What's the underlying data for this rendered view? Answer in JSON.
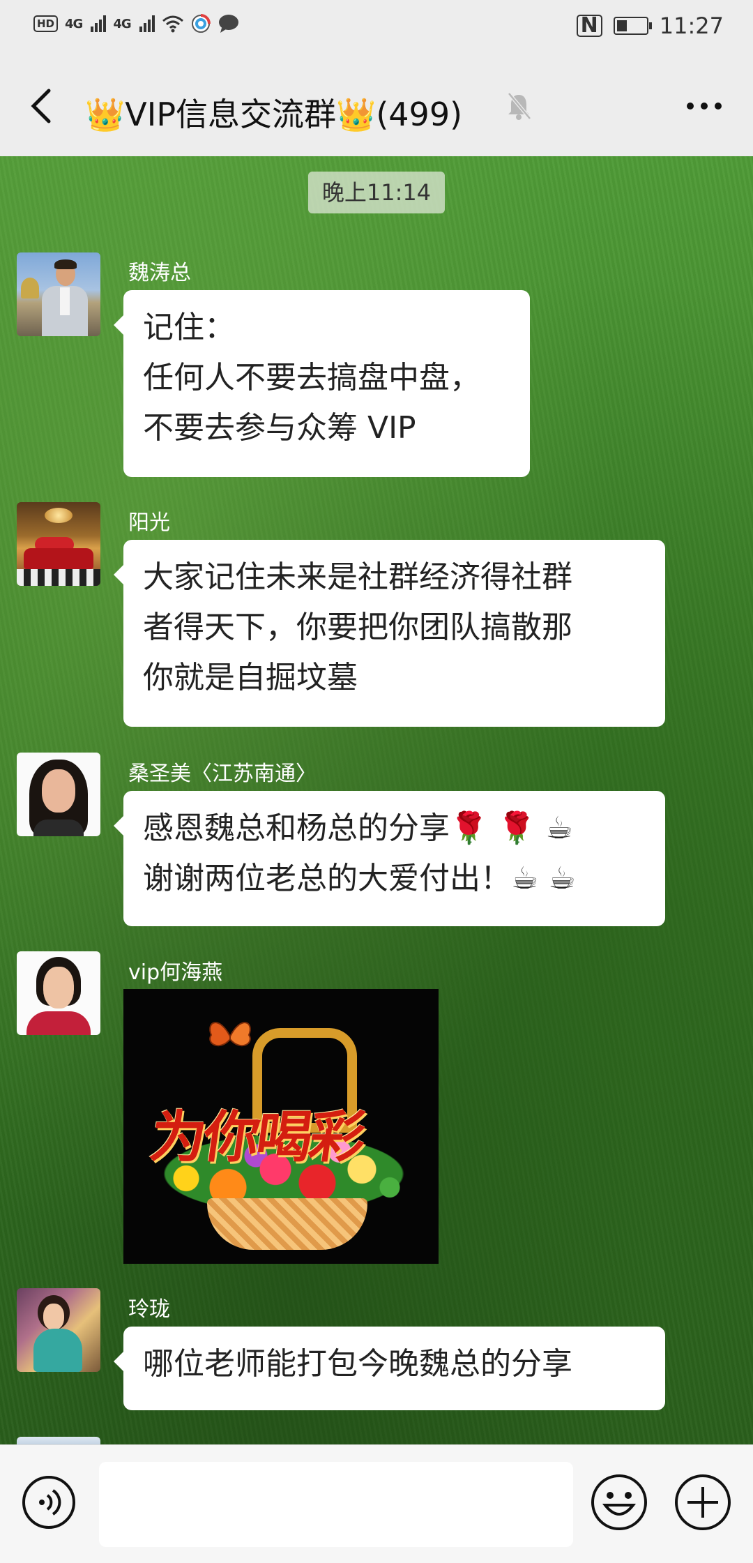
{
  "status_bar": {
    "hd": "HD",
    "signal1": "4G",
    "signal2": "4G",
    "nfc": "N",
    "time": "11:27"
  },
  "header": {
    "crown": "👑",
    "title": "VIP信息交流群",
    "member_count": "(499)"
  },
  "chat": {
    "timestamp": "晚上11:14",
    "messages": [
      {
        "sender": "魏涛总",
        "lines": [
          "记住：",
          "任何人不要去搞盘中盘，",
          "不要去参与众筹 VIP"
        ]
      },
      {
        "sender": "阳光",
        "lines": [
          "大家记住未来是社群经济得社群",
          "者得天下，你要把你团队搞散那",
          "你就是自掘坟墓"
        ]
      },
      {
        "sender": "桑圣美〈江苏南通〉",
        "lines": [
          "感恩魏总和杨总的分享🌹 🌹 ☕",
          "谢谢两位老总的大爱付出！☕ ☕"
        ]
      },
      {
        "sender": "vip何海燕",
        "image_text": "为你喝彩"
      },
      {
        "sender": "玲珑",
        "lines": [
          "哪位老师能打包今晚魏总的分享"
        ]
      }
    ]
  },
  "input_bar": {
    "placeholder": ""
  },
  "colors": {
    "header_bg": "#ededed",
    "bubble_bg": "#ffffff",
    "chat_bg": "#3d8128"
  },
  "icons": [
    "back-arrow-icon",
    "mute-bell-icon",
    "more-dots-icon",
    "voice-icon",
    "emoji-icon",
    "plus-icon"
  ]
}
